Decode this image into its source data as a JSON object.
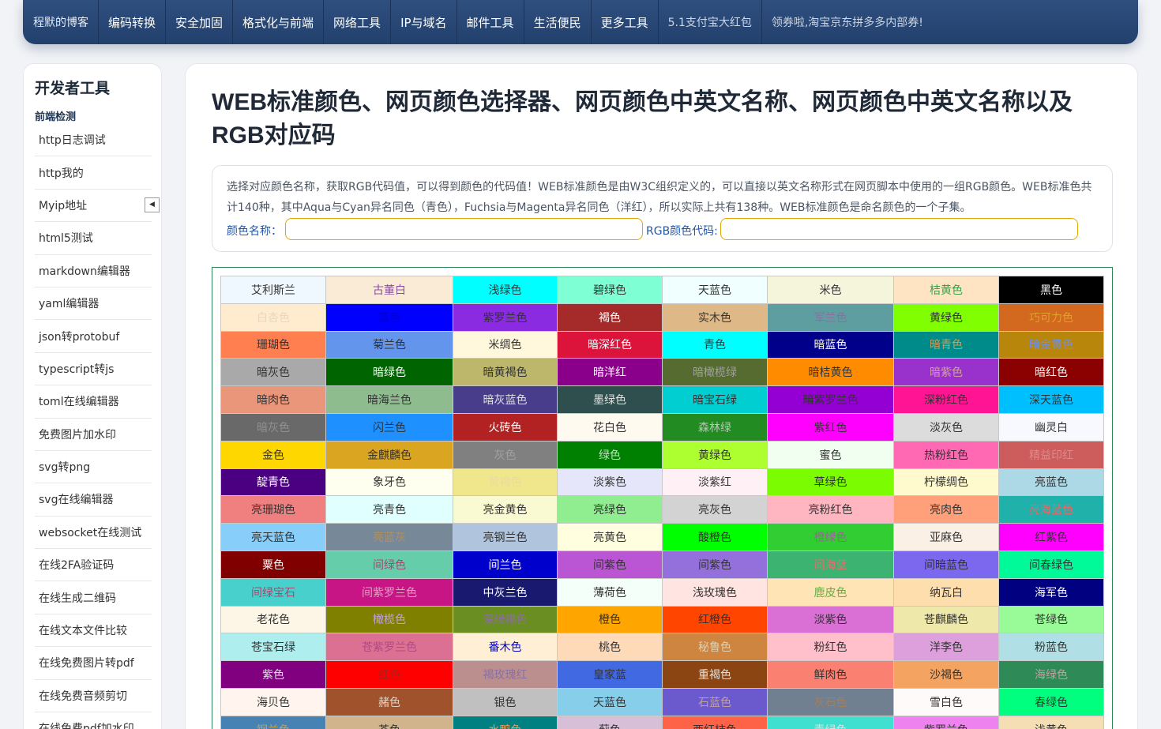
{
  "nav": {
    "brand": "程默的博客",
    "items": [
      "编码转换",
      "安全加固",
      "格式化与前端",
      "网络工具",
      "IP与域名",
      "邮件工具",
      "生活便民",
      "更多工具"
    ],
    "promos": [
      "5.1支付宝大红包",
      "领券啦,淘宝京东拼多多内部券!"
    ]
  },
  "sidebar": {
    "title": "开发者工具",
    "group": "前端检测",
    "collapse_icon": "◀",
    "items": [
      "http日志调试",
      "http我的",
      "Myip地址",
      "html5测试",
      "markdown编辑器",
      "yaml编辑器",
      "json转protobuf",
      "typescript转js",
      "toml在线编辑器",
      "免费图片加水印",
      "svg转png",
      "svg在线编辑器",
      "websocket在线测试",
      "在线2FA验证码",
      "在线生成二维码",
      "在线文本文件比较",
      "在线免费图片转pdf",
      "在线免费音频剪切",
      "在线免费pdf加水印"
    ]
  },
  "main": {
    "title": "WEB标准颜色、网页颜色选择器、网页颜色中英文名称、网页颜色中英文名称以及RGB对应码",
    "description": "选择对应颜色名称，获取RGB代码值，可以得到颜色的代码值！WEB标准颜色是由W3C组织定义的，可以直接以英文名称形式在网页脚本中使用的一组RGB颜色。WEB标准色共计140种，其中Aqua与Cyan异名同色（青色），Fuchsia与Magenta异名同色（洋红），所以实际上共有138种。WEB标准颜色是命名颜色的一个子集。",
    "color_name_label": "颜色名称：",
    "rgb_label": "RGB颜色代码:",
    "color_name_value": "",
    "rgb_value": ""
  },
  "colors": [
    [
      [
        "艾利斯兰",
        "#F0F8FF",
        "#333333"
      ],
      [
        "古董白",
        "#FAEBD7",
        "#8a4fa0"
      ],
      [
        "浅绿色",
        "#00FFFF",
        "#333333"
      ],
      [
        "碧绿色",
        "#7FFFD4",
        "#333333"
      ],
      [
        "天蓝色",
        "#F0FFFF",
        "#333333"
      ],
      [
        "米色",
        "#F5F5DC",
        "#333333"
      ],
      [
        "桔黄色",
        "#FFE4C4",
        "#3aa04a"
      ],
      [
        "黑色",
        "#000000",
        "#ffffff"
      ]
    ],
    [
      [
        "白杏色",
        "#FFEBCD",
        "#e8d8c0"
      ],
      [
        "蓝色",
        "#0000FF",
        "#0000cc"
      ],
      [
        "紫罗兰色",
        "#8A2BE2",
        "#333333"
      ],
      [
        "褐色",
        "#A52A2A",
        "#ffffff"
      ],
      [
        "实木色",
        "#DEB887",
        "#333333"
      ],
      [
        "军兰色",
        "#5F9EA0",
        "#8a6fa0"
      ],
      [
        "黄绿色",
        "#7FFF00",
        "#333333"
      ],
      [
        "巧可力色",
        "#D2691E",
        "#e0a030"
      ]
    ],
    [
      [
        "珊瑚色",
        "#FF7F50",
        "#333333"
      ],
      [
        "菊兰色",
        "#6495ED",
        "#333333"
      ],
      [
        "米绸色",
        "#FFF8DC",
        "#333333"
      ],
      [
        "暗深红色",
        "#DC143C",
        "#ffffff"
      ],
      [
        "青色",
        "#00FFFF",
        "#333333"
      ],
      [
        "暗蓝色",
        "#00008B",
        "#ffffff"
      ],
      [
        "暗青色",
        "#008B8B",
        "#c0a060"
      ],
      [
        "暗金黄色",
        "#B8860B",
        "#7090e0"
      ]
    ],
    [
      [
        "暗灰色",
        "#A9A9A9",
        "#333333"
      ],
      [
        "暗绿色",
        "#006400",
        "#ffffff"
      ],
      [
        "暗黄褐色",
        "#BDB76B",
        "#333333"
      ],
      [
        "暗洋红",
        "#8B008B",
        "#ffffff"
      ],
      [
        "暗橄榄绿",
        "#556B2F",
        "#a0a0a0"
      ],
      [
        "暗桔黄色",
        "#FF8C00",
        "#333333"
      ],
      [
        "暗紫色",
        "#9932CC",
        "#d0a0a0"
      ],
      [
        "暗红色",
        "#8B0000",
        "#ffffff"
      ]
    ],
    [
      [
        "暗肉色",
        "#E9967A",
        "#333333"
      ],
      [
        "暗海兰色",
        "#8FBC8F",
        "#333333"
      ],
      [
        "暗灰蓝色",
        "#483D8B",
        "#e0e0e0"
      ],
      [
        "墨绿色",
        "#2F4F4F",
        "#e0e0e0"
      ],
      [
        "暗宝石绿",
        "#00CED1",
        "#333333"
      ],
      [
        "暗紫罗兰色",
        "#9400D3",
        "#333333"
      ],
      [
        "深粉红色",
        "#FF1493",
        "#333333"
      ],
      [
        "深天蓝色",
        "#00BFFF",
        "#333333"
      ]
    ],
    [
      [
        "暗灰色",
        "#696969",
        "#909090"
      ],
      [
        "闪兰色",
        "#1E90FF",
        "#333333"
      ],
      [
        "火砖色",
        "#B22222",
        "#ffffff"
      ],
      [
        "花白色",
        "#FFFAF0",
        "#333333"
      ],
      [
        "森林绿",
        "#228B22",
        "#c0c0c0"
      ],
      [
        "紫红色",
        "#FF00FF",
        "#333333"
      ],
      [
        "淡灰色",
        "#DCDCDC",
        "#333333"
      ],
      [
        "幽灵白",
        "#F8F8FF",
        "#333333"
      ]
    ],
    [
      [
        "金色",
        "#FFD700",
        "#333333"
      ],
      [
        "金麒麟色",
        "#DAA520",
        "#333333"
      ],
      [
        "灰色",
        "#808080",
        "#a0a0a0"
      ],
      [
        "绿色",
        "#008000",
        "#c0e0c0"
      ],
      [
        "黄绿色",
        "#ADFF2F",
        "#333333"
      ],
      [
        "蜜色",
        "#F0FFF0",
        "#333333"
      ],
      [
        "热粉红色",
        "#FF69B4",
        "#333333"
      ],
      [
        "精益印红",
        "#CD5C5C",
        "#e08a8a"
      ]
    ],
    [
      [
        "靛青色",
        "#4B0082",
        "#ffffff"
      ],
      [
        "象牙色",
        "#FFFFF0",
        "#333333"
      ],
      [
        "黄褐色",
        "#F0E68C",
        "#e8dca0"
      ],
      [
        "淡紫色",
        "#E6E6FA",
        "#333333"
      ],
      [
        "淡紫红",
        "#FFF0F5",
        "#333333"
      ],
      [
        "草绿色",
        "#7CFC00",
        "#333333"
      ],
      [
        "柠檬绸色",
        "#FFFACD",
        "#333333"
      ],
      [
        "亮蓝色",
        "#ADD8E6",
        "#333333"
      ]
    ],
    [
      [
        "亮珊瑚色",
        "#F08080",
        "#333333"
      ],
      [
        "亮青色",
        "#E0FFFF",
        "#333333"
      ],
      [
        "亮金黄色",
        "#FAFAD2",
        "#333333"
      ],
      [
        "亮绿色",
        "#90EE90",
        "#333333"
      ],
      [
        "亮灰色",
        "#D3D3D3",
        "#333333"
      ],
      [
        "亮粉红色",
        "#FFB6C1",
        "#333333"
      ],
      [
        "亮肉色",
        "#FFA07A",
        "#333333"
      ],
      [
        "亮海蓝色",
        "#20B2AA",
        "#e06a6a"
      ]
    ],
    [
      [
        "亮天蓝色",
        "#87CEFA",
        "#333333"
      ],
      [
        "亮蓝灰",
        "#778899",
        "#b09060"
      ],
      [
        "亮钢兰色",
        "#B0C4DE",
        "#333333"
      ],
      [
        "亮黄色",
        "#FFFFE0",
        "#333333"
      ],
      [
        "酸橙色",
        "#00FF00",
        "#333333"
      ],
      [
        "橙绿色",
        "#32CD32",
        "#a060a0"
      ],
      [
        "亚麻色",
        "#FAF0E6",
        "#333333"
      ],
      [
        "红紫色",
        "#FF00FF",
        "#333333"
      ]
    ],
    [
      [
        "粟色",
        "#800000",
        "#ffffff"
      ],
      [
        "间绿色",
        "#66CDAA",
        "#a04a70"
      ],
      [
        "间兰色",
        "#0000CD",
        "#ffffff"
      ],
      [
        "间紫色",
        "#BA55D3",
        "#333333"
      ],
      [
        "间紫色",
        "#9370DB",
        "#333333"
      ],
      [
        "间海蓝",
        "#3CB371",
        "#e07070"
      ],
      [
        "间暗蓝色",
        "#7B68EE",
        "#333333"
      ],
      [
        "间春绿色",
        "#00FA9A",
        "#333333"
      ]
    ],
    [
      [
        "间绿宝石",
        "#48D1CC",
        "#a04a70"
      ],
      [
        "间紫罗兰色",
        "#C71585",
        "#e0a0c0"
      ],
      [
        "中灰兰色",
        "#191970",
        "#ffffff"
      ],
      [
        "薄荷色",
        "#F5FFFA",
        "#333333"
      ],
      [
        "浅玫瑰色",
        "#FFE4E1",
        "#333333"
      ],
      [
        "鹿皮色",
        "#FFE4B5",
        "#60b040"
      ],
      [
        "纳瓦白",
        "#FFDEAD",
        "#333333"
      ],
      [
        "海军色",
        "#000080",
        "#ffffff"
      ]
    ],
    [
      [
        "老花色",
        "#FDF5E6",
        "#333333"
      ],
      [
        "橄榄色",
        "#808000",
        "#c0a0e0"
      ],
      [
        "深绿褐色",
        "#6B8E23",
        "#8a6fa0"
      ],
      [
        "橙色",
        "#FFA500",
        "#333333"
      ],
      [
        "红橙色",
        "#FF4500",
        "#333333"
      ],
      [
        "淡紫色",
        "#DA70D6",
        "#333333"
      ],
      [
        "苍麒麟色",
        "#EEE8AA",
        "#333333"
      ],
      [
        "苍绿色",
        "#98FB98",
        "#333333"
      ]
    ],
    [
      [
        "苍宝石绿",
        "#AFEEEE",
        "#333333"
      ],
      [
        "苍紫罗兰色",
        "#DB7093",
        "#b04a80"
      ],
      [
        "番木色",
        "#FFEFD5",
        "#0000cc"
      ],
      [
        "桃色",
        "#FFDAB9",
        "#333333"
      ],
      [
        "秘鲁色",
        "#CD853F",
        "#e0d0b0"
      ],
      [
        "粉红色",
        "#FFC0CB",
        "#333333"
      ],
      [
        "洋李色",
        "#DDA0DD",
        "#333333"
      ],
      [
        "粉蓝色",
        "#B0E0E6",
        "#333333"
      ]
    ],
    [
      [
        "紫色",
        "#800080",
        "#e0e0e0"
      ],
      [
        "红色",
        "#FF0000",
        "#aa2020"
      ],
      [
        "褐玫瑰红",
        "#BC8F8F",
        "#8a6fa0"
      ],
      [
        "皇家蓝",
        "#4169E1",
        "#333333"
      ],
      [
        "重褐色",
        "#8B4513",
        "#e0e0e0"
      ],
      [
        "鲜肉色",
        "#FA8072",
        "#333333"
      ],
      [
        "沙褐色",
        "#F4A460",
        "#333333"
      ],
      [
        "海绿色",
        "#2E8B57",
        "#c0a0a0"
      ]
    ],
    [
      [
        "海贝色",
        "#FFF5EE",
        "#333333"
      ],
      [
        "赭色",
        "#A0522D",
        "#e0d0c0"
      ],
      [
        "银色",
        "#C0C0C0",
        "#333333"
      ],
      [
        "天蓝色",
        "#87CEEB",
        "#333333"
      ],
      [
        "石蓝色",
        "#6A5ACD",
        "#c0a0a0"
      ],
      [
        "灰石色",
        "#708090",
        "#a08060"
      ],
      [
        "雪白色",
        "#FFFAFA",
        "#333333"
      ],
      [
        "春绿色",
        "#00FF7F",
        "#333333"
      ]
    ],
    [
      [
        "钢兰色",
        "#4682B4",
        "#c0a060"
      ],
      [
        "茶色",
        "#D2B48C",
        "#333333"
      ],
      [
        "水鸭色",
        "#008080",
        "#e0a060"
      ],
      [
        "蓟色",
        "#D8BFD8",
        "#333333"
      ],
      [
        "西红柿色",
        "#FF6347",
        "#333333"
      ],
      [
        "青绿色",
        "#40E0D0",
        "#e0e0e0"
      ],
      [
        "紫罗兰色",
        "#EE82EE",
        "#333333"
      ],
      [
        "浅黄色",
        "#F5DEB3",
        "#333333"
      ]
    ]
  ]
}
